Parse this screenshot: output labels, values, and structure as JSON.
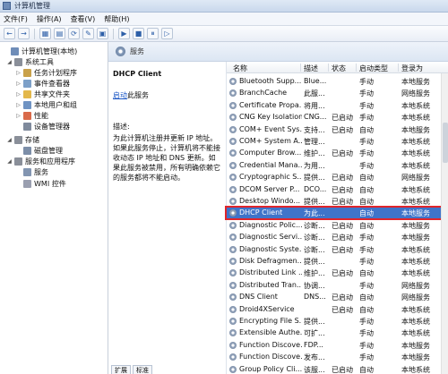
{
  "window": {
    "title": "计算机管理"
  },
  "menu": [
    "文件(F)",
    "操作(A)",
    "查看(V)",
    "帮助(H)"
  ],
  "toolbar": [
    "←",
    "→",
    "▦",
    "▤",
    "⟳",
    "✎",
    "▣",
    "▶",
    "■",
    "⏸",
    "▷"
  ],
  "tree": [
    {
      "label": "计算机管理(本地)",
      "indent": 0,
      "toggle": "",
      "icon": "computer-icon",
      "color": "#6f8db8"
    },
    {
      "label": "系统工具",
      "indent": 1,
      "toggle": "◢",
      "icon": "tools-icon",
      "color": "#8a8f99"
    },
    {
      "label": "任务计划程序",
      "indent": 2,
      "toggle": "▷",
      "icon": "clock-icon",
      "color": "#c9a14a"
    },
    {
      "label": "事件查看器",
      "indent": 2,
      "toggle": "▷",
      "icon": "event-viewer-icon",
      "color": "#7da0c8"
    },
    {
      "label": "共享文件夹",
      "indent": 2,
      "toggle": "▷",
      "icon": "folder-icon",
      "color": "#e3b84b"
    },
    {
      "label": "本地用户和组",
      "indent": 2,
      "toggle": "▷",
      "icon": "users-icon",
      "color": "#6f93c3"
    },
    {
      "label": "性能",
      "indent": 2,
      "toggle": "▷",
      "icon": "performance-icon",
      "color": "#d96a4a"
    },
    {
      "label": "设备管理器",
      "indent": 2,
      "toggle": "",
      "icon": "device-manager-icon",
      "color": "#7f8a9c"
    },
    {
      "label": "存储",
      "indent": 1,
      "toggle": "◢",
      "icon": "storage-icon",
      "color": "#8a8f99"
    },
    {
      "label": "磁盘管理",
      "indent": 2,
      "toggle": "",
      "icon": "disk-icon",
      "color": "#7c8ea8"
    },
    {
      "label": "服务和应用程序",
      "indent": 1,
      "toggle": "◢",
      "icon": "apps-icon",
      "color": "#8a8f99"
    },
    {
      "label": "服务",
      "indent": 2,
      "toggle": "",
      "icon": "services-icon",
      "color": "#8295b1"
    },
    {
      "label": "WMI 控件",
      "indent": 2,
      "toggle": "",
      "icon": "wmi-icon",
      "color": "#9a9fb0"
    }
  ],
  "header": {
    "title": "服务"
  },
  "desc": {
    "service_name": "DHCP Client",
    "start_link": "启动",
    "start_suffix": "此服务",
    "label": "描述:",
    "text": "为此计算机注册并更新 IP 地址。如果此服务停止，计算机将不能接收动态 IP 地址和 DNS 更新。如果此服务被禁用，所有明确依赖它的服务都将不能启动。"
  },
  "columns": [
    "名称",
    "描述",
    "状态",
    "启动类型",
    "登录为"
  ],
  "rows": [
    [
      "Bluetooth Supp...",
      "Blue...",
      "",
      "手动",
      "本地服务"
    ],
    [
      "BranchCache",
      "此服...",
      "",
      "手动",
      "网络服务"
    ],
    [
      "Certificate Propa...",
      "将用...",
      "",
      "手动",
      "本地系统"
    ],
    [
      "CNG Key Isolation",
      "CNG...",
      "已启动",
      "手动",
      "本地系统"
    ],
    [
      "COM+ Event Sys...",
      "支持...",
      "已启动",
      "自动",
      "本地服务"
    ],
    [
      "COM+ System A...",
      "管理...",
      "",
      "手动",
      "本地系统"
    ],
    [
      "Computer Brow...",
      "维护...",
      "已启动",
      "手动",
      "本地系统"
    ],
    [
      "Credential Mana...",
      "为用...",
      "",
      "手动",
      "本地系统"
    ],
    [
      "Cryptographic S...",
      "提供...",
      "已启动",
      "自动",
      "网络服务"
    ],
    [
      "DCOM Server P...",
      "DCO...",
      "已启动",
      "自动",
      "本地系统"
    ],
    [
      "Desktop Windo...",
      "提供...",
      "已启动",
      "自动",
      "本地系统"
    ],
    [
      "DHCP Client",
      "为此...",
      "",
      "自动",
      "本地服务"
    ],
    [
      "Diagnostic Polic...",
      "诊断...",
      "已启动",
      "自动",
      "本地服务"
    ],
    [
      "Diagnostic Servi...",
      "诊断...",
      "已启动",
      "手动",
      "本地服务"
    ],
    [
      "Diagnostic Syste...",
      "诊断...",
      "已启动",
      "手动",
      "本地系统"
    ],
    [
      "Disk Defragmen...",
      "提供...",
      "",
      "手动",
      "本地系统"
    ],
    [
      "Distributed Link ...",
      "维护...",
      "已启动",
      "自动",
      "本地系统"
    ],
    [
      "Distributed Tran...",
      "协调...",
      "",
      "手动",
      "网络服务"
    ],
    [
      "DNS Client",
      "DNS...",
      "已启动",
      "自动",
      "网络服务"
    ],
    [
      "Droid4XService",
      "",
      "已启动",
      "自动",
      "本地系统"
    ],
    [
      "Encrypting File S...",
      "提供...",
      "",
      "手动",
      "本地系统"
    ],
    [
      "Extensible Authe...",
      "可扩...",
      "",
      "手动",
      "本地系统"
    ],
    [
      "Function Discove...",
      "FDP...",
      "",
      "手动",
      "本地服务"
    ],
    [
      "Function Discove...",
      "发布...",
      "",
      "手动",
      "本地服务"
    ],
    [
      "Group Policy Cli...",
      "该服...",
      "已启动",
      "自动",
      "本地系统"
    ]
  ],
  "selected_row": 11,
  "bottom_tabs": [
    "扩展",
    "标准"
  ]
}
